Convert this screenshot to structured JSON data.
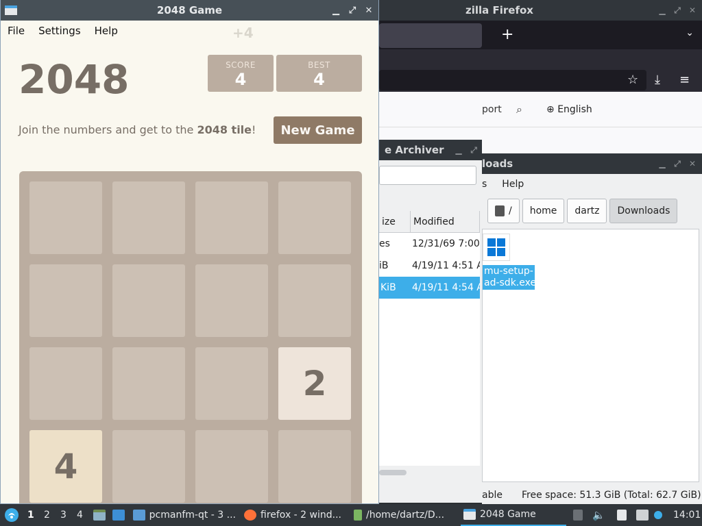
{
  "firefox": {
    "title": "zilla Firefox",
    "new_tab": "+",
    "tab_menu": "⌄",
    "support": "port",
    "language": "English"
  },
  "archiver": {
    "title": "e Archiver",
    "columns": [
      "ize",
      "Modified"
    ],
    "rows": [
      {
        "size": "es",
        "modified": "12/31/69 7:00"
      },
      {
        "size": "iB",
        "modified": "4/19/11 4:51 A"
      },
      {
        "size": "KiB",
        "modified": "4/19/11 4:54 A"
      }
    ]
  },
  "downloads": {
    "title": "loads",
    "menu": [
      "s",
      "Help"
    ],
    "path": [
      "/",
      "home",
      "dartz",
      "Downloads"
    ],
    "file_name": "mu-setup-\nad-sdk.exe",
    "status_left": "able",
    "status_free": "Free space: 51.3 GiB (Total: 62.7 GiB)"
  },
  "game": {
    "window_title": "2048 Game",
    "menu": [
      "File",
      "Settings",
      "Help"
    ],
    "title": "2048",
    "score_label": "SCORE",
    "score": "4",
    "best_label": "BEST",
    "best": "4",
    "ghost_add": "+4",
    "intro_pre": "Join the numbers and get to the ",
    "intro_bold": "2048 tile",
    "intro_post": "!",
    "new_game": "New Game",
    "tiles": [
      {
        "row": 2,
        "col": 3,
        "value": "2"
      },
      {
        "row": 3,
        "col": 0,
        "value": "4"
      }
    ]
  },
  "taskbar": {
    "desktops": [
      "1",
      "2",
      "3",
      "4"
    ],
    "tasks": [
      {
        "label": "pcmanfm-qt - 3 ...",
        "icon": "folder-icon"
      },
      {
        "label": "firefox - 2 wind...",
        "icon": "firefox-icon"
      },
      {
        "label": "/home/dartz/D...",
        "icon": "archive-icon"
      },
      {
        "label": "2048 Game",
        "icon": "window-icon"
      }
    ],
    "clock": "14:01"
  },
  "colors": {
    "titlebar": "#31363b",
    "board": "#bbada0",
    "accent": "#3daee9",
    "button": "#8f7a66"
  }
}
